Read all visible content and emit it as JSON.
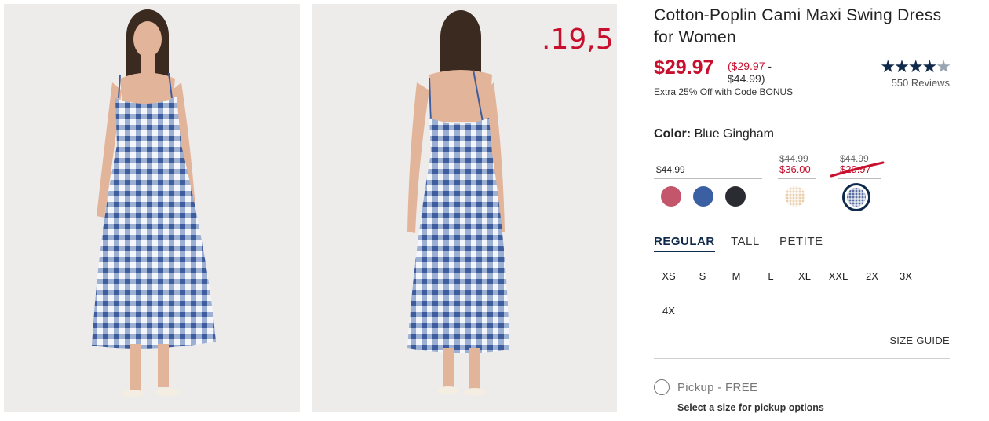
{
  "product": {
    "title": "Cotton-Poplin Cami Maxi Swing Dress for Women",
    "price_now": "$29.97",
    "price_range_low": "($29.97",
    "price_range_sep": " -",
    "price_range_high": "$44.99)",
    "promo": "Extra 25% Off with Code BONUS",
    "rating_value": 4.5,
    "stars": "★★★★",
    "half_star": "★",
    "reviews": "550 Reviews"
  },
  "handwritten_note": ".19,5",
  "color": {
    "label": "Color:",
    "value": "Blue Gingham",
    "groups": [
      {
        "price": "$44.99"
      },
      {
        "strike": "$44.99",
        "sale": "$36.00"
      },
      {
        "strike": "$44.99",
        "sale": "$29.97"
      }
    ],
    "swatches": [
      {
        "name": "rose",
        "color": "#c4566b"
      },
      {
        "name": "blue",
        "color": "#3a5fa3"
      },
      {
        "name": "black",
        "color": "#2b2b32"
      },
      {
        "name": "tan-gingham",
        "color": "#e9cfb0"
      },
      {
        "name": "blue-gingham",
        "color": "#5a6ea0",
        "selected": true
      }
    ]
  },
  "fit_tabs": [
    "REGULAR",
    "TALL",
    "PETITE"
  ],
  "sizes": [
    "XS",
    "S",
    "M",
    "L",
    "XL",
    "XXL",
    "2X",
    "3X",
    "4X"
  ],
  "size_guide": "SIZE GUIDE",
  "pickup": {
    "label": "Pickup - FREE",
    "note": "Select a size for pickup options"
  }
}
